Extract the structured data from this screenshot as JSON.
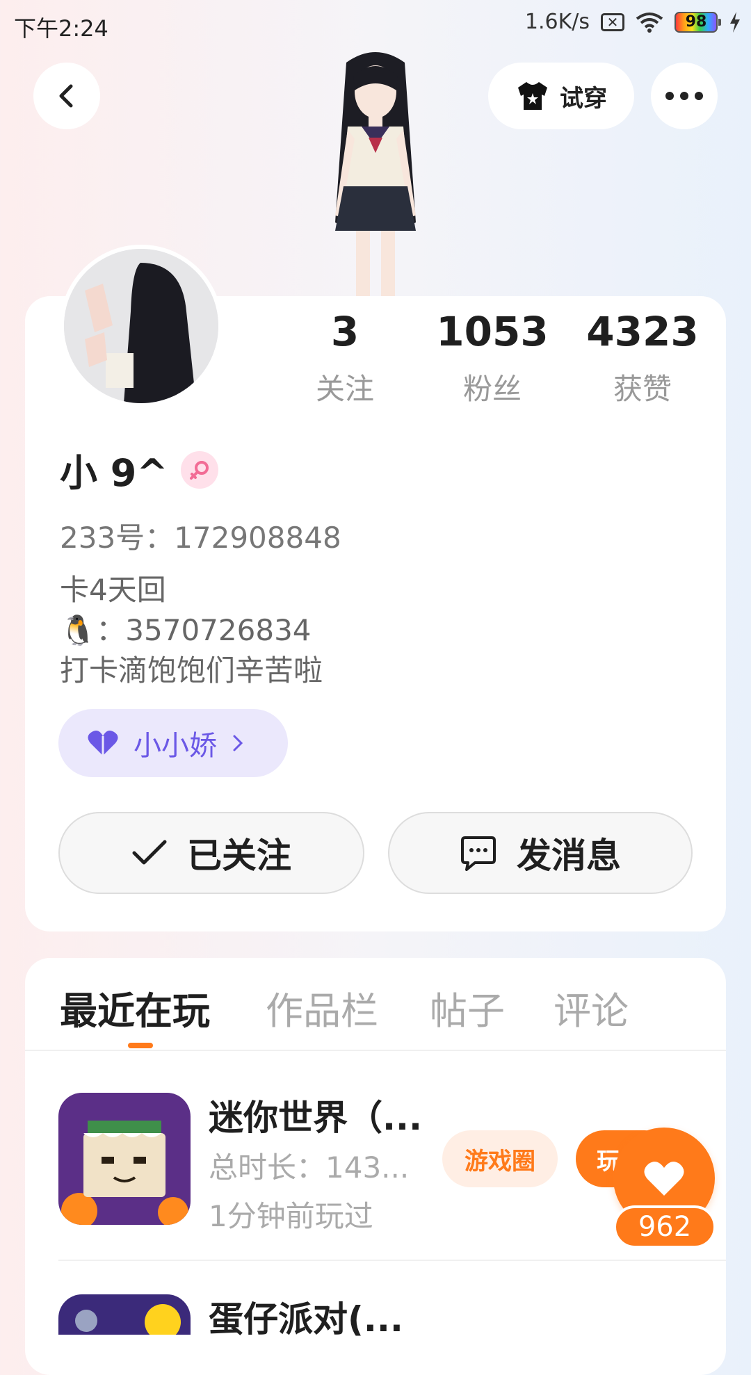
{
  "status_bar": {
    "time": "下午2:24",
    "speed": "1.6K/s",
    "battery": "98",
    "icons": [
      "sim-x-icon",
      "wifi-icon",
      "battery-icon",
      "charging-icon"
    ]
  },
  "header": {
    "tryon_label": "试穿",
    "icons": [
      "back-icon",
      "shirt-icon",
      "more-icon"
    ]
  },
  "profile": {
    "stats": [
      {
        "value": "3",
        "label": "关注"
      },
      {
        "value": "1053",
        "label": "粉丝"
      },
      {
        "value": "4323",
        "label": "获赞"
      }
    ],
    "nickname": "小 9^",
    "gender": "female",
    "uid": "233号：172908848",
    "bio": [
      "卡4天回",
      "🐧：3570726834",
      "打卡滴饱饱们辛苦啦"
    ],
    "cp_name": "小小娇",
    "follow_label": "已关注",
    "message_label": "发消息"
  },
  "tabs": [
    {
      "label": "最近在玩",
      "active": true
    },
    {
      "label": "作品栏",
      "active": false
    },
    {
      "label": "帖子",
      "active": false
    },
    {
      "label": "评论",
      "active": false
    }
  ],
  "games": [
    {
      "title": "迷你世界（...",
      "duration": "总时长：143...",
      "last_played": "1分钟前玩过",
      "circle_label": "游戏圈",
      "play_label": "玩"
    },
    {
      "title": "蛋仔派对(..."
    }
  ],
  "like": {
    "count": "962"
  },
  "colors": {
    "accent": "#ff7a1a",
    "accent_light": "#ffeee4",
    "cp_purple": "#6b58e6",
    "cp_bg": "#ebe8fc"
  }
}
